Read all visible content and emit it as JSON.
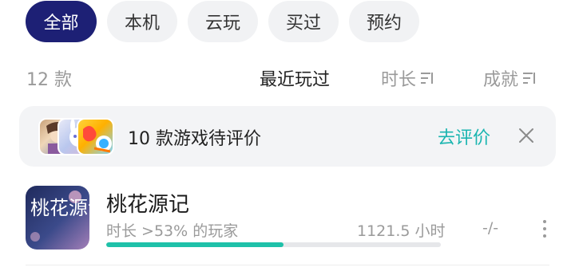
{
  "filters": {
    "items": [
      "全部",
      "本机",
      "云玩",
      "买过",
      "预约"
    ],
    "active_index": 0
  },
  "list_header": {
    "count": "12 款",
    "sort_recent": "最近玩过",
    "sort_duration": "时长",
    "sort_achievement": "成就"
  },
  "review_banner": {
    "text": "10 款游戏待评价",
    "action": "去评价",
    "close_icon": "close-icon"
  },
  "game": {
    "title": "桃花源记",
    "percentile": "时长 >53% 的玩家",
    "hours": "1121.5 小时",
    "achievement": "-/-",
    "progress_fraction": 0.53,
    "icon_text": "桃花源记"
  },
  "colors": {
    "active_chip": "#1d2075",
    "accent_link": "#1ab5b0",
    "progress": "#1fc1a9"
  }
}
